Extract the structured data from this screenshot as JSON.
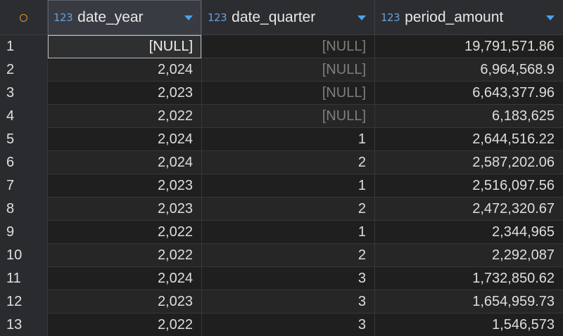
{
  "columns": [
    {
      "type_icon": "123",
      "title": "date_year"
    },
    {
      "type_icon": "123",
      "title": "date_quarter"
    },
    {
      "type_icon": "123",
      "title": "period_amount"
    }
  ],
  "rows": [
    {
      "n": "1",
      "date_year": "[NULL]",
      "date_quarter": "[NULL]",
      "period_amount": "19,791,571.86"
    },
    {
      "n": "2",
      "date_year": "2,024",
      "date_quarter": "[NULL]",
      "period_amount": "6,964,568.9"
    },
    {
      "n": "3",
      "date_year": "2,023",
      "date_quarter": "[NULL]",
      "period_amount": "6,643,377.96"
    },
    {
      "n": "4",
      "date_year": "2,022",
      "date_quarter": "[NULL]",
      "period_amount": "6,183,625"
    },
    {
      "n": "5",
      "date_year": "2,024",
      "date_quarter": "1",
      "period_amount": "2,644,516.22"
    },
    {
      "n": "6",
      "date_year": "2,024",
      "date_quarter": "2",
      "period_amount": "2,587,202.06"
    },
    {
      "n": "7",
      "date_year": "2,023",
      "date_quarter": "1",
      "period_amount": "2,516,097.56"
    },
    {
      "n": "8",
      "date_year": "2,023",
      "date_quarter": "2",
      "period_amount": "2,472,320.67"
    },
    {
      "n": "9",
      "date_year": "2,022",
      "date_quarter": "1",
      "period_amount": "2,344,965"
    },
    {
      "n": "10",
      "date_year": "2,022",
      "date_quarter": "2",
      "period_amount": "2,292,087"
    },
    {
      "n": "11",
      "date_year": "2,024",
      "date_quarter": "3",
      "period_amount": "1,732,850.62"
    },
    {
      "n": "12",
      "date_year": "2,023",
      "date_quarter": "3",
      "period_amount": "1,654,959.73"
    },
    {
      "n": "13",
      "date_year": "2,022",
      "date_quarter": "3",
      "period_amount": "1,546,573"
    }
  ],
  "colors": {
    "accent_corner": "#e8922e",
    "type_icon": "#6a9fd8",
    "sort_arrow": "#4aa3ee",
    "null_text": "#7e7e7e"
  },
  "icons": {
    "corner": "circle-icon",
    "sort": "sort-desc-icon"
  }
}
